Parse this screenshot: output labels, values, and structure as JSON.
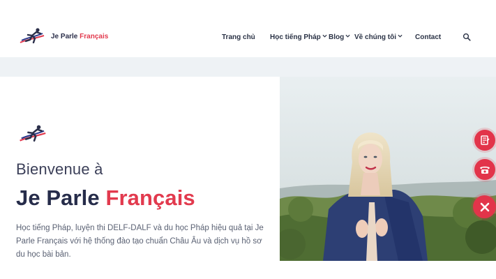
{
  "header": {
    "brand_main": "Je Parle ",
    "brand_accent": "Français",
    "nav": [
      {
        "label": "Trang chủ",
        "has_dropdown": false
      },
      {
        "label": "Học tiếng Pháp",
        "has_dropdown": true
      },
      {
        "label": "Blog",
        "has_dropdown": true
      },
      {
        "label": "Về chúng tôi",
        "has_dropdown": true
      },
      {
        "label": "Contact",
        "has_dropdown": false
      }
    ],
    "search_icon": "search-icon"
  },
  "hero": {
    "welcome": "Bienvenue à",
    "title_main": "Je Parle ",
    "title_accent": "Français",
    "description": "Học tiếng Pháp, luyện thi DELF-DALF và du học Pháp hiệu quả tại Je Parle Français với hệ thống đào tạo chuẩn Châu Âu và dịch vụ hồ sơ du học bài bản."
  },
  "floating_buttons": [
    {
      "icon": "form-icon"
    },
    {
      "icon": "phone-icon"
    },
    {
      "icon": "close-icon"
    }
  ],
  "colors": {
    "brand_navy": "#262c4a",
    "brand_red": "#e23a4e",
    "band": "#eef2f5"
  }
}
